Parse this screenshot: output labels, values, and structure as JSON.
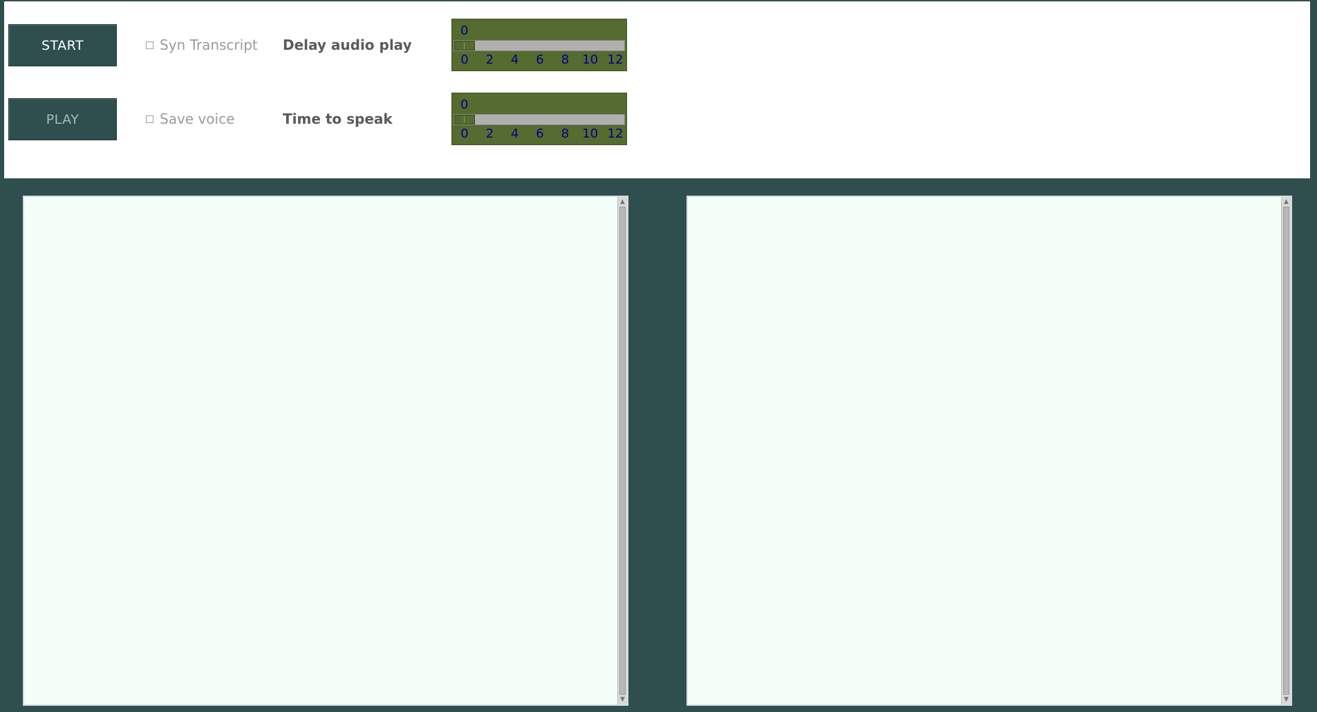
{
  "controls": {
    "start_label": "START",
    "play_label": "PLAY",
    "syn_transcript_label": "Syn Transcript",
    "save_voice_label": "Save voice",
    "delay_label": "Delay audio play",
    "time_label": "Time to speak"
  },
  "delay_scale": {
    "value": "0",
    "min": 0,
    "max": 12,
    "ticks": [
      "0",
      "2",
      "4",
      "6",
      "8",
      "10",
      "12"
    ]
  },
  "time_scale": {
    "value": "0",
    "min": 0,
    "max": 12,
    "ticks": [
      "0",
      "2",
      "4",
      "6",
      "8",
      "10",
      "12"
    ]
  },
  "panes": {
    "left_text": "",
    "right_text": ""
  },
  "colors": {
    "background": "#2f4f4f",
    "scale_bg": "#556b2f",
    "scale_text": "#00008b",
    "text_area": "#f5fffa"
  },
  "icons": {
    "scroll_up": "arrow-up-icon",
    "scroll_down": "arrow-down-icon"
  }
}
